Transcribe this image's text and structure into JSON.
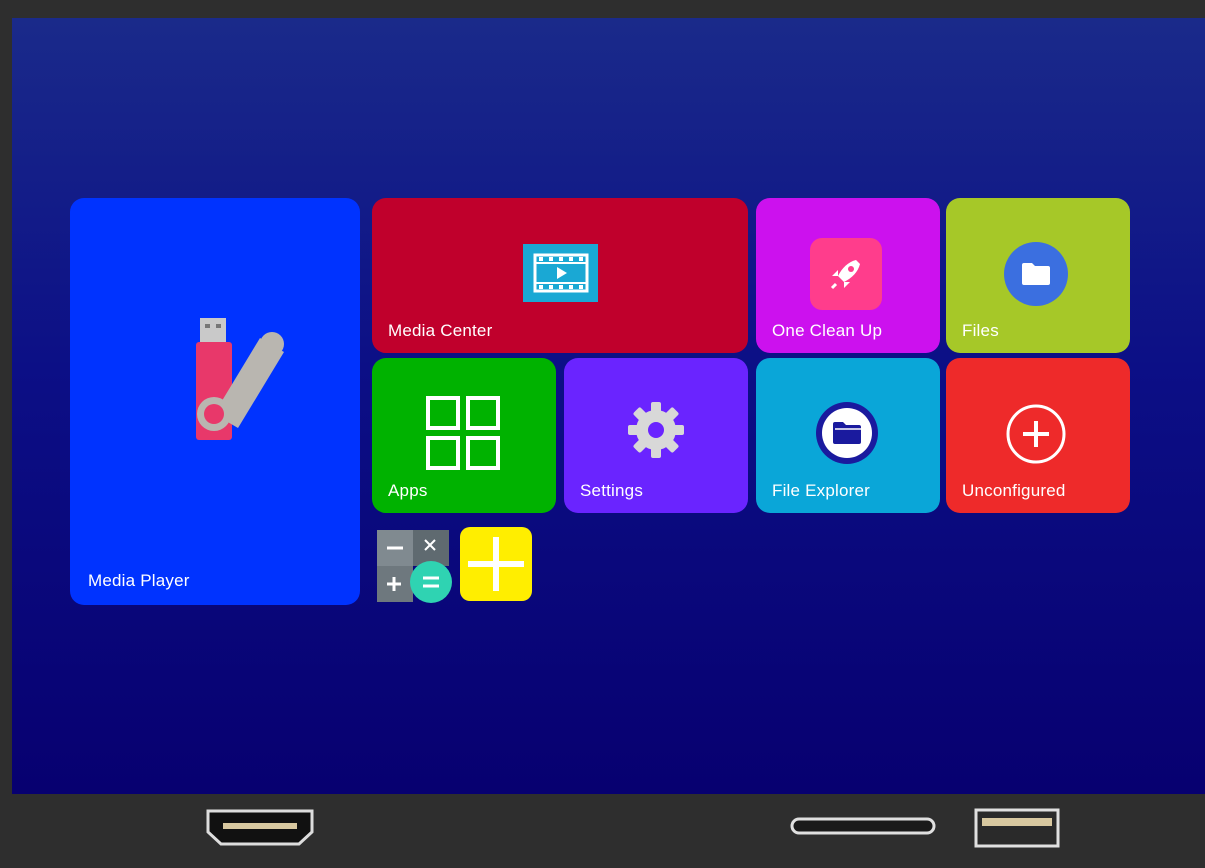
{
  "tiles": {
    "media_player": {
      "label": "Media Player",
      "color": "#0033ff",
      "icon": "usb-drive-icon"
    },
    "media_center": {
      "label": "Media Center",
      "color": "#c0002c",
      "icon": "film-play-icon"
    },
    "one_clean_up": {
      "label": "One Clean Up",
      "color": "#cc11ee",
      "icon": "rocket-icon"
    },
    "files": {
      "label": "Files",
      "color": "#a6c828",
      "icon": "folder-icon"
    },
    "apps": {
      "label": "Apps",
      "color": "#00b200",
      "icon": "grid-icon"
    },
    "settings": {
      "label": "Settings",
      "color": "#6a24ff",
      "icon": "gear-icon"
    },
    "file_explorer": {
      "label": "File Explorer",
      "color": "#0aa6d8",
      "icon": "folder-explorer-icon"
    },
    "unconfigured": {
      "label": "Unconfigured",
      "color": "#ee2a2a",
      "icon": "plus-circle-icon"
    },
    "calculator": {
      "icon": "calculator-icon"
    },
    "add": {
      "icon": "plus-icon",
      "color": "#ffee00"
    }
  },
  "ports": [
    "hdmi-port-icon",
    "card-slot-icon",
    "usb-port-icon"
  ]
}
